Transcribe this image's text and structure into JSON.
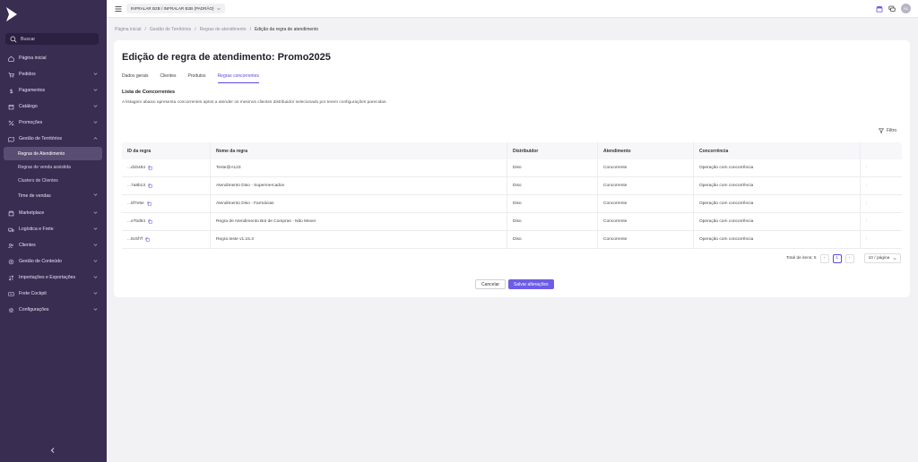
{
  "colors": {
    "sidebar_bg": "#3a2d52",
    "accent": "#6c5ce7",
    "active_tab": "#5b4bd6"
  },
  "topbar": {
    "store": "INFRALAR B2B / INFRALAR B2B (PADRÃO)",
    "avatar_initials": "AL"
  },
  "sidebar": {
    "search_label": "Buscar",
    "items": [
      {
        "label": "Página inicial",
        "icon": "home-icon"
      },
      {
        "label": "Pedidos",
        "icon": "cart-icon"
      },
      {
        "label": "Pagamentos",
        "icon": "dollar-icon"
      },
      {
        "label": "Catálogo",
        "icon": "catalog-icon"
      },
      {
        "label": "Promoções",
        "icon": "percent-icon"
      },
      {
        "label": "Gestão de Territórios",
        "icon": "territory-icon"
      }
    ],
    "sub_items": [
      {
        "label": "Regras de Atendimento"
      },
      {
        "label": "Regras de venda assistida"
      },
      {
        "label": "Clusters de Clientes"
      },
      {
        "label": "Time de vendas"
      }
    ],
    "items2": [
      {
        "label": "Marketplace",
        "icon": "marketplace-icon"
      },
      {
        "label": "Logística e Frete",
        "icon": "truck-icon"
      },
      {
        "label": "Clientes",
        "icon": "users-icon"
      },
      {
        "label": "Gestão de Conteúdo",
        "icon": "content-icon"
      },
      {
        "label": "Importações e Exportações",
        "icon": "import-export-icon"
      },
      {
        "label": "Frete Cockpit",
        "icon": "cockpit-icon"
      },
      {
        "label": "Configurações",
        "icon": "gear-icon"
      }
    ]
  },
  "breadcrumb": [
    "Página inicial",
    "Gestão de Territórios",
    "Regras de atendimento",
    "Edição da regra de atendimento"
  ],
  "page": {
    "title": "Edição de regra de atendimento: Promo2025",
    "tabs": [
      "Dados gerais",
      "Clientes",
      "Produtos",
      "Regras concorrentes"
    ],
    "section_title": "Lista de Concorrentes",
    "section_desc": "A listagem abaixo apresenta concorrentes aptos a atender os mesmos clientes distribuidor selecionado por terem configurações parecidas.",
    "filter_label": "Filtro"
  },
  "table": {
    "headers": [
      "ID da regra",
      "Nome da regra",
      "Distribuidor",
      "Atendimento",
      "Concorrência"
    ],
    "rows": [
      {
        "id": "...d1b484",
        "name": "Teste@A123",
        "distribuidor": "Diso",
        "atendimento": "Concorrente",
        "concorrencia": "Operação com concorrência"
      },
      {
        "id": "...7a8b13",
        "name": "Atendimento Diso - Supermercados",
        "distribuidor": "Diso",
        "atendimento": "Concorrente",
        "concorrencia": "Operação com concorrência"
      },
      {
        "id": "...5f7e5e",
        "name": "Atendimento Diso - Farmácias",
        "distribuidor": "Diso",
        "atendimento": "Concorrente",
        "concorrencia": "Operação com concorrência"
      },
      {
        "id": "...e7bd64",
        "name": "Regra de Atendimento Bot de Compras - Não Mexer",
        "distribuidor": "Diso",
        "atendimento": "Concorrente",
        "concorrencia": "Operação com concorrência"
      },
      {
        "id": "...6c5f7f",
        "name": "Regra teste v1.15.3",
        "distribuidor": "Diso",
        "atendimento": "Concorrente",
        "concorrencia": "Operação com concorrência"
      }
    ],
    "row_action": ":"
  },
  "pagination": {
    "total_label": "Total de itens: 5",
    "prev": "‹",
    "current": "1",
    "next": "›",
    "page_size": "10 / página"
  },
  "actions": {
    "cancel": "Cancelar",
    "save": "Salvar alterações"
  }
}
